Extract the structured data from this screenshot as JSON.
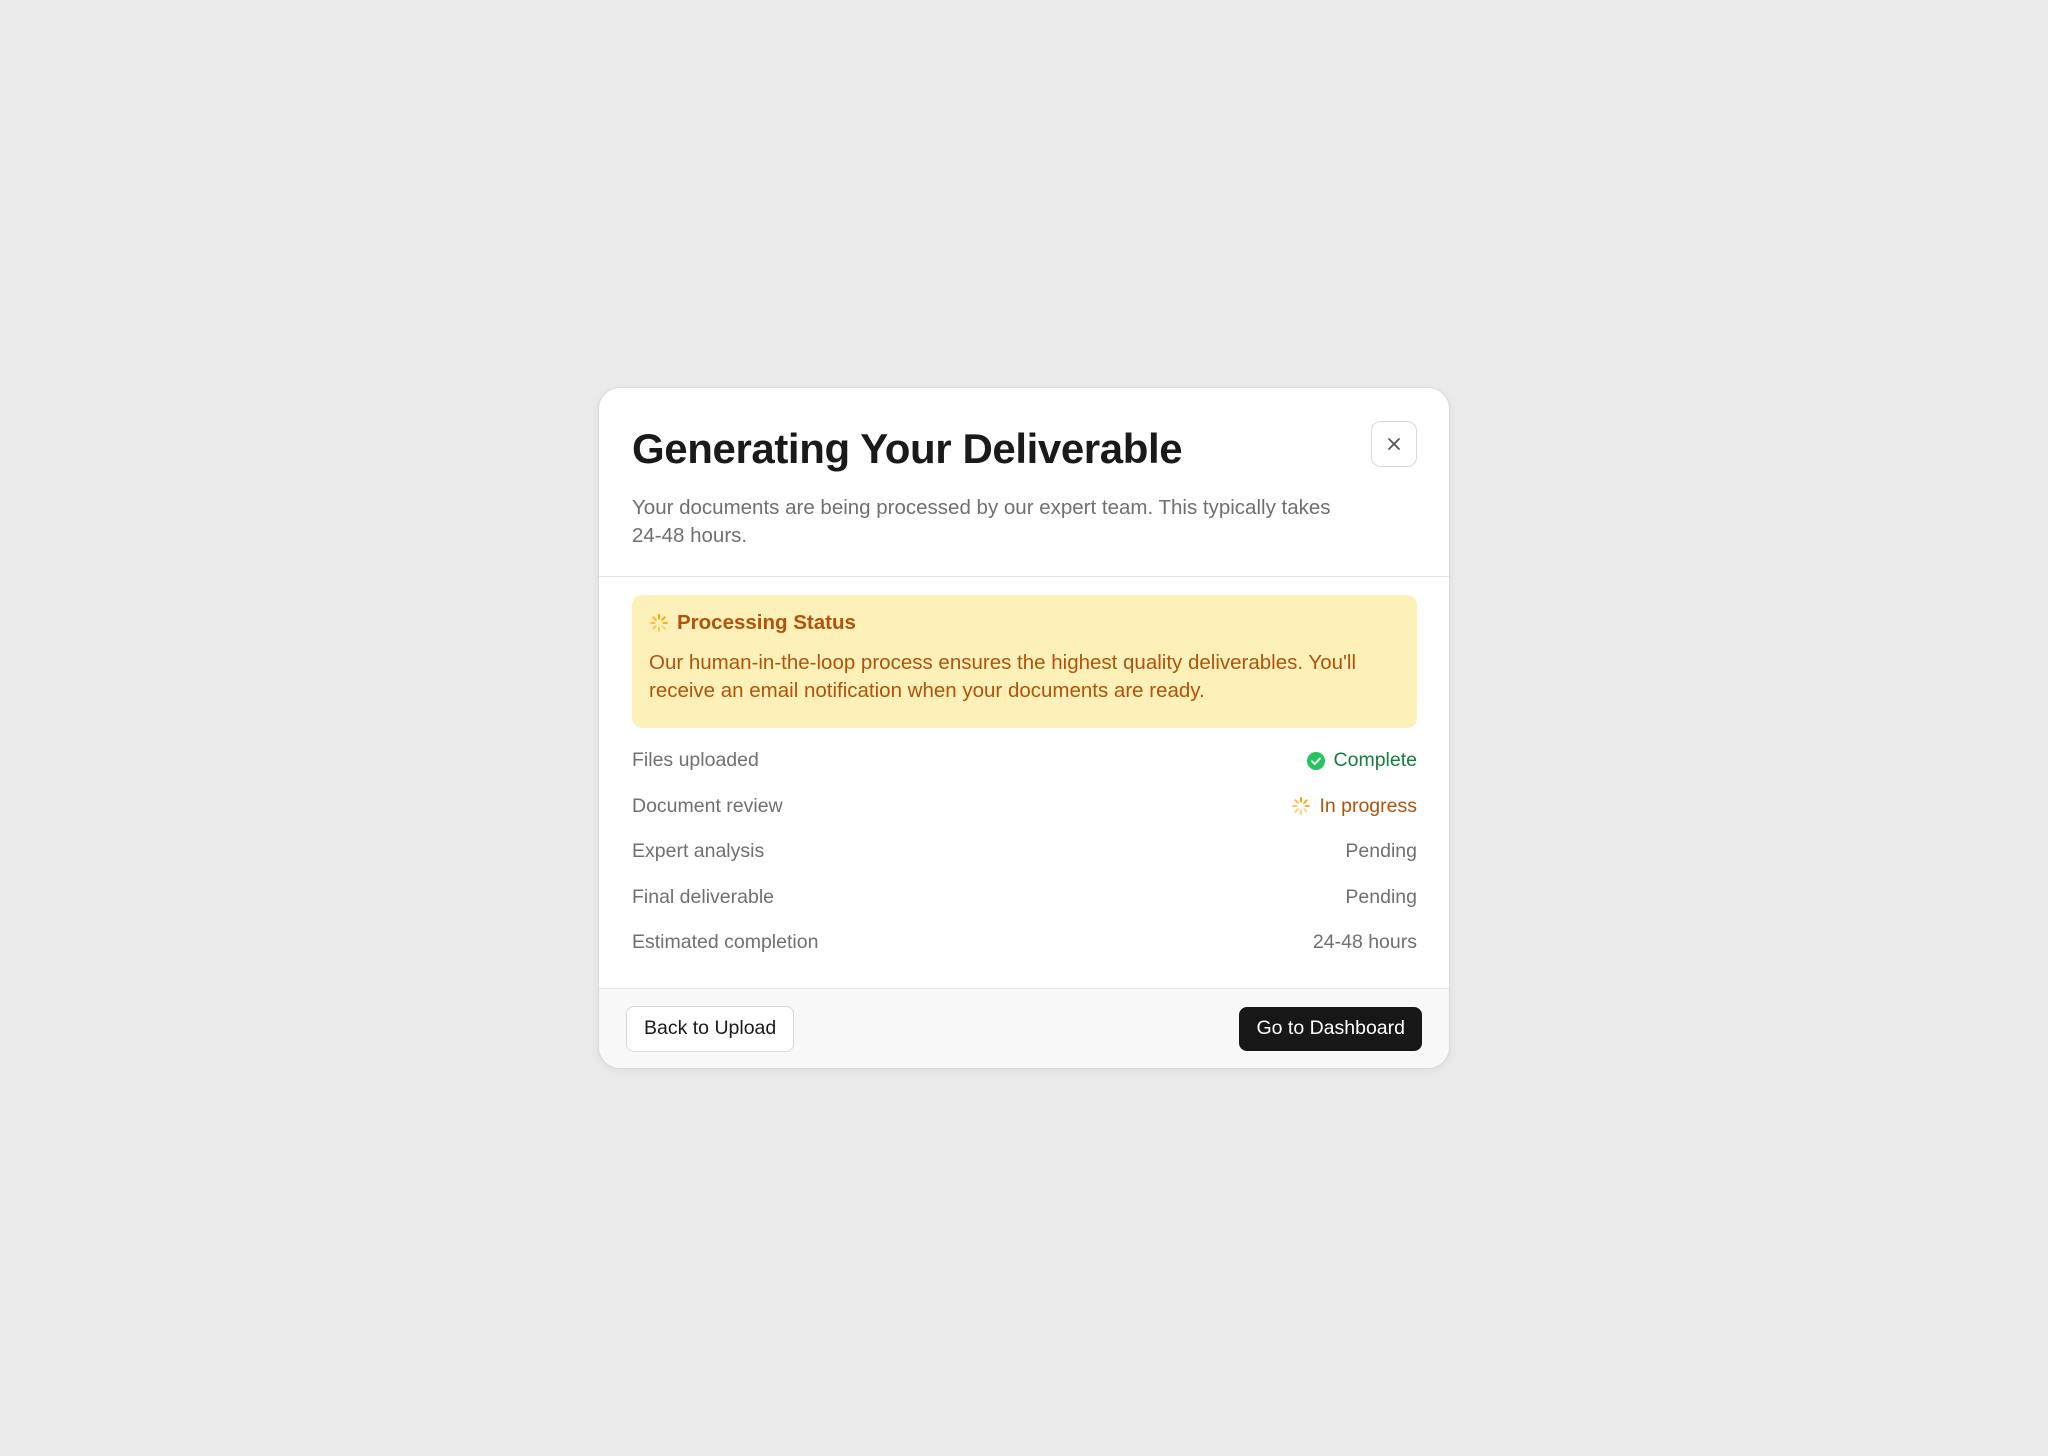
{
  "modal": {
    "title": "Generating Your Deliverable",
    "subtitle": "Your documents are being processed by our expert team. This typically takes 24-48 hours.",
    "close_icon": "close-icon"
  },
  "alert": {
    "icon": "spinner-icon",
    "title": "Processing Status",
    "text": "Our human-in-the-loop process ensures the highest quality deliverables. You'll receive an email notification when your documents are ready."
  },
  "status_rows": [
    {
      "label": "Files uploaded",
      "value": "Complete",
      "state": "complete",
      "icon": "check-circle-icon"
    },
    {
      "label": "Document review",
      "value": "In progress",
      "state": "progress",
      "icon": "spinner-icon"
    },
    {
      "label": "Expert analysis",
      "value": "Pending",
      "state": "pending"
    },
    {
      "label": "Final deliverable",
      "value": "Pending",
      "state": "pending"
    },
    {
      "label": "Estimated completion",
      "value": "24-48 hours",
      "state": "pending"
    }
  ],
  "footer": {
    "back_label": "Back to Upload",
    "dashboard_label": "Go to Dashboard"
  },
  "colors": {
    "background": "#ebebeb",
    "alert_bg": "#fdf0b8",
    "alert_text": "#b35309",
    "complete": "#22c55e",
    "complete_text": "#15803d",
    "primary_button": "#171717"
  }
}
